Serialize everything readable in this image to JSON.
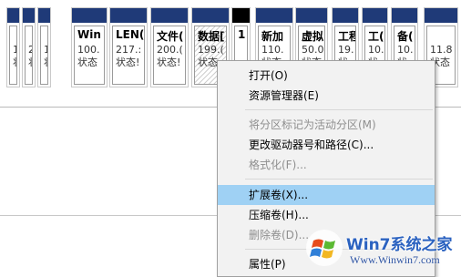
{
  "partitions": [
    {
      "name": "",
      "size": "1(",
      "state": "状"
    },
    {
      "name": "",
      "size": "2",
      "state": "状"
    },
    {
      "name": "",
      "size": "1(",
      "state": "状"
    },
    {
      "name": "Win",
      "size": "100.",
      "state": "状态"
    },
    {
      "name": "LEN(",
      "size": "217.:",
      "state": "状态!"
    },
    {
      "name": "文件(",
      "size": "200.(",
      "state": "状态!"
    },
    {
      "name": "数据[",
      "size": "199.(",
      "state": "状态"
    },
    {
      "name": "",
      "size": "",
      "state": ""
    },
    {
      "name": "新加",
      "size": "110.",
      "state": "状态"
    },
    {
      "name": "虚拟",
      "size": "50.0",
      "state": "状态"
    },
    {
      "name": "工程",
      "size": "19.",
      "state": "状"
    },
    {
      "name": "工(",
      "size": "10.",
      "state": "状"
    },
    {
      "name": "备(",
      "size": "10.",
      "state": "状"
    },
    {
      "name": "",
      "size": "11.8",
      "state": "状态"
    }
  ],
  "small_label": "1",
  "context_menu": {
    "items": [
      {
        "label": "打开(O)",
        "enabled": true
      },
      {
        "label": "资源管理器(E)",
        "enabled": true
      },
      {
        "label": "将分区标记为活动分区(M)",
        "enabled": false
      },
      {
        "label": "更改驱动器号和路径(C)...",
        "enabled": true
      },
      {
        "label": "格式化(F)...",
        "enabled": false
      },
      {
        "label": "扩展卷(X)...",
        "enabled": true,
        "highlighted": true
      },
      {
        "label": "压缩卷(H)...",
        "enabled": true
      },
      {
        "label": "删除卷(D)...",
        "enabled": false
      },
      {
        "label": "属性(P)",
        "enabled": true
      }
    ]
  },
  "watermark": {
    "title": "Win7系统之家",
    "url": "Www.Winwin7.com"
  },
  "colors": {
    "header_bar": "#1f3a78",
    "menu_highlight": "#9fd1f4",
    "menu_bg": "#f2f2f2",
    "disabled_text": "#8f8f8f"
  }
}
